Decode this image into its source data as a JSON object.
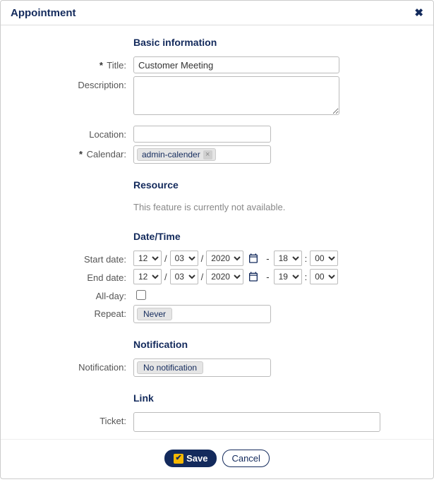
{
  "dialog": {
    "title": "Appointment"
  },
  "sections": {
    "basic": "Basic information",
    "resource": "Resource",
    "datetime": "Date/Time",
    "notification": "Notification",
    "link": "Link"
  },
  "labels": {
    "title": "Title:",
    "description": "Description:",
    "location": "Location:",
    "calendar": "Calendar:",
    "start_date": "Start date:",
    "end_date": "End date:",
    "all_day": "All-day:",
    "repeat": "Repeat:",
    "notification": "Notification:",
    "ticket": "Ticket:"
  },
  "fields": {
    "title": "Customer Meeting",
    "description": "",
    "location": "",
    "calendar_tag": "admin-calender",
    "ticket": ""
  },
  "resource_note": "This feature is currently not available.",
  "start": {
    "month": "12",
    "day": "03",
    "year": "2020",
    "hour": "18",
    "minute": "00"
  },
  "end": {
    "month": "12",
    "day": "03",
    "year": "2020",
    "hour": "19",
    "minute": "00"
  },
  "repeat_value": "Never",
  "notification_value": "No notification",
  "buttons": {
    "save": "Save",
    "cancel": "Cancel"
  }
}
